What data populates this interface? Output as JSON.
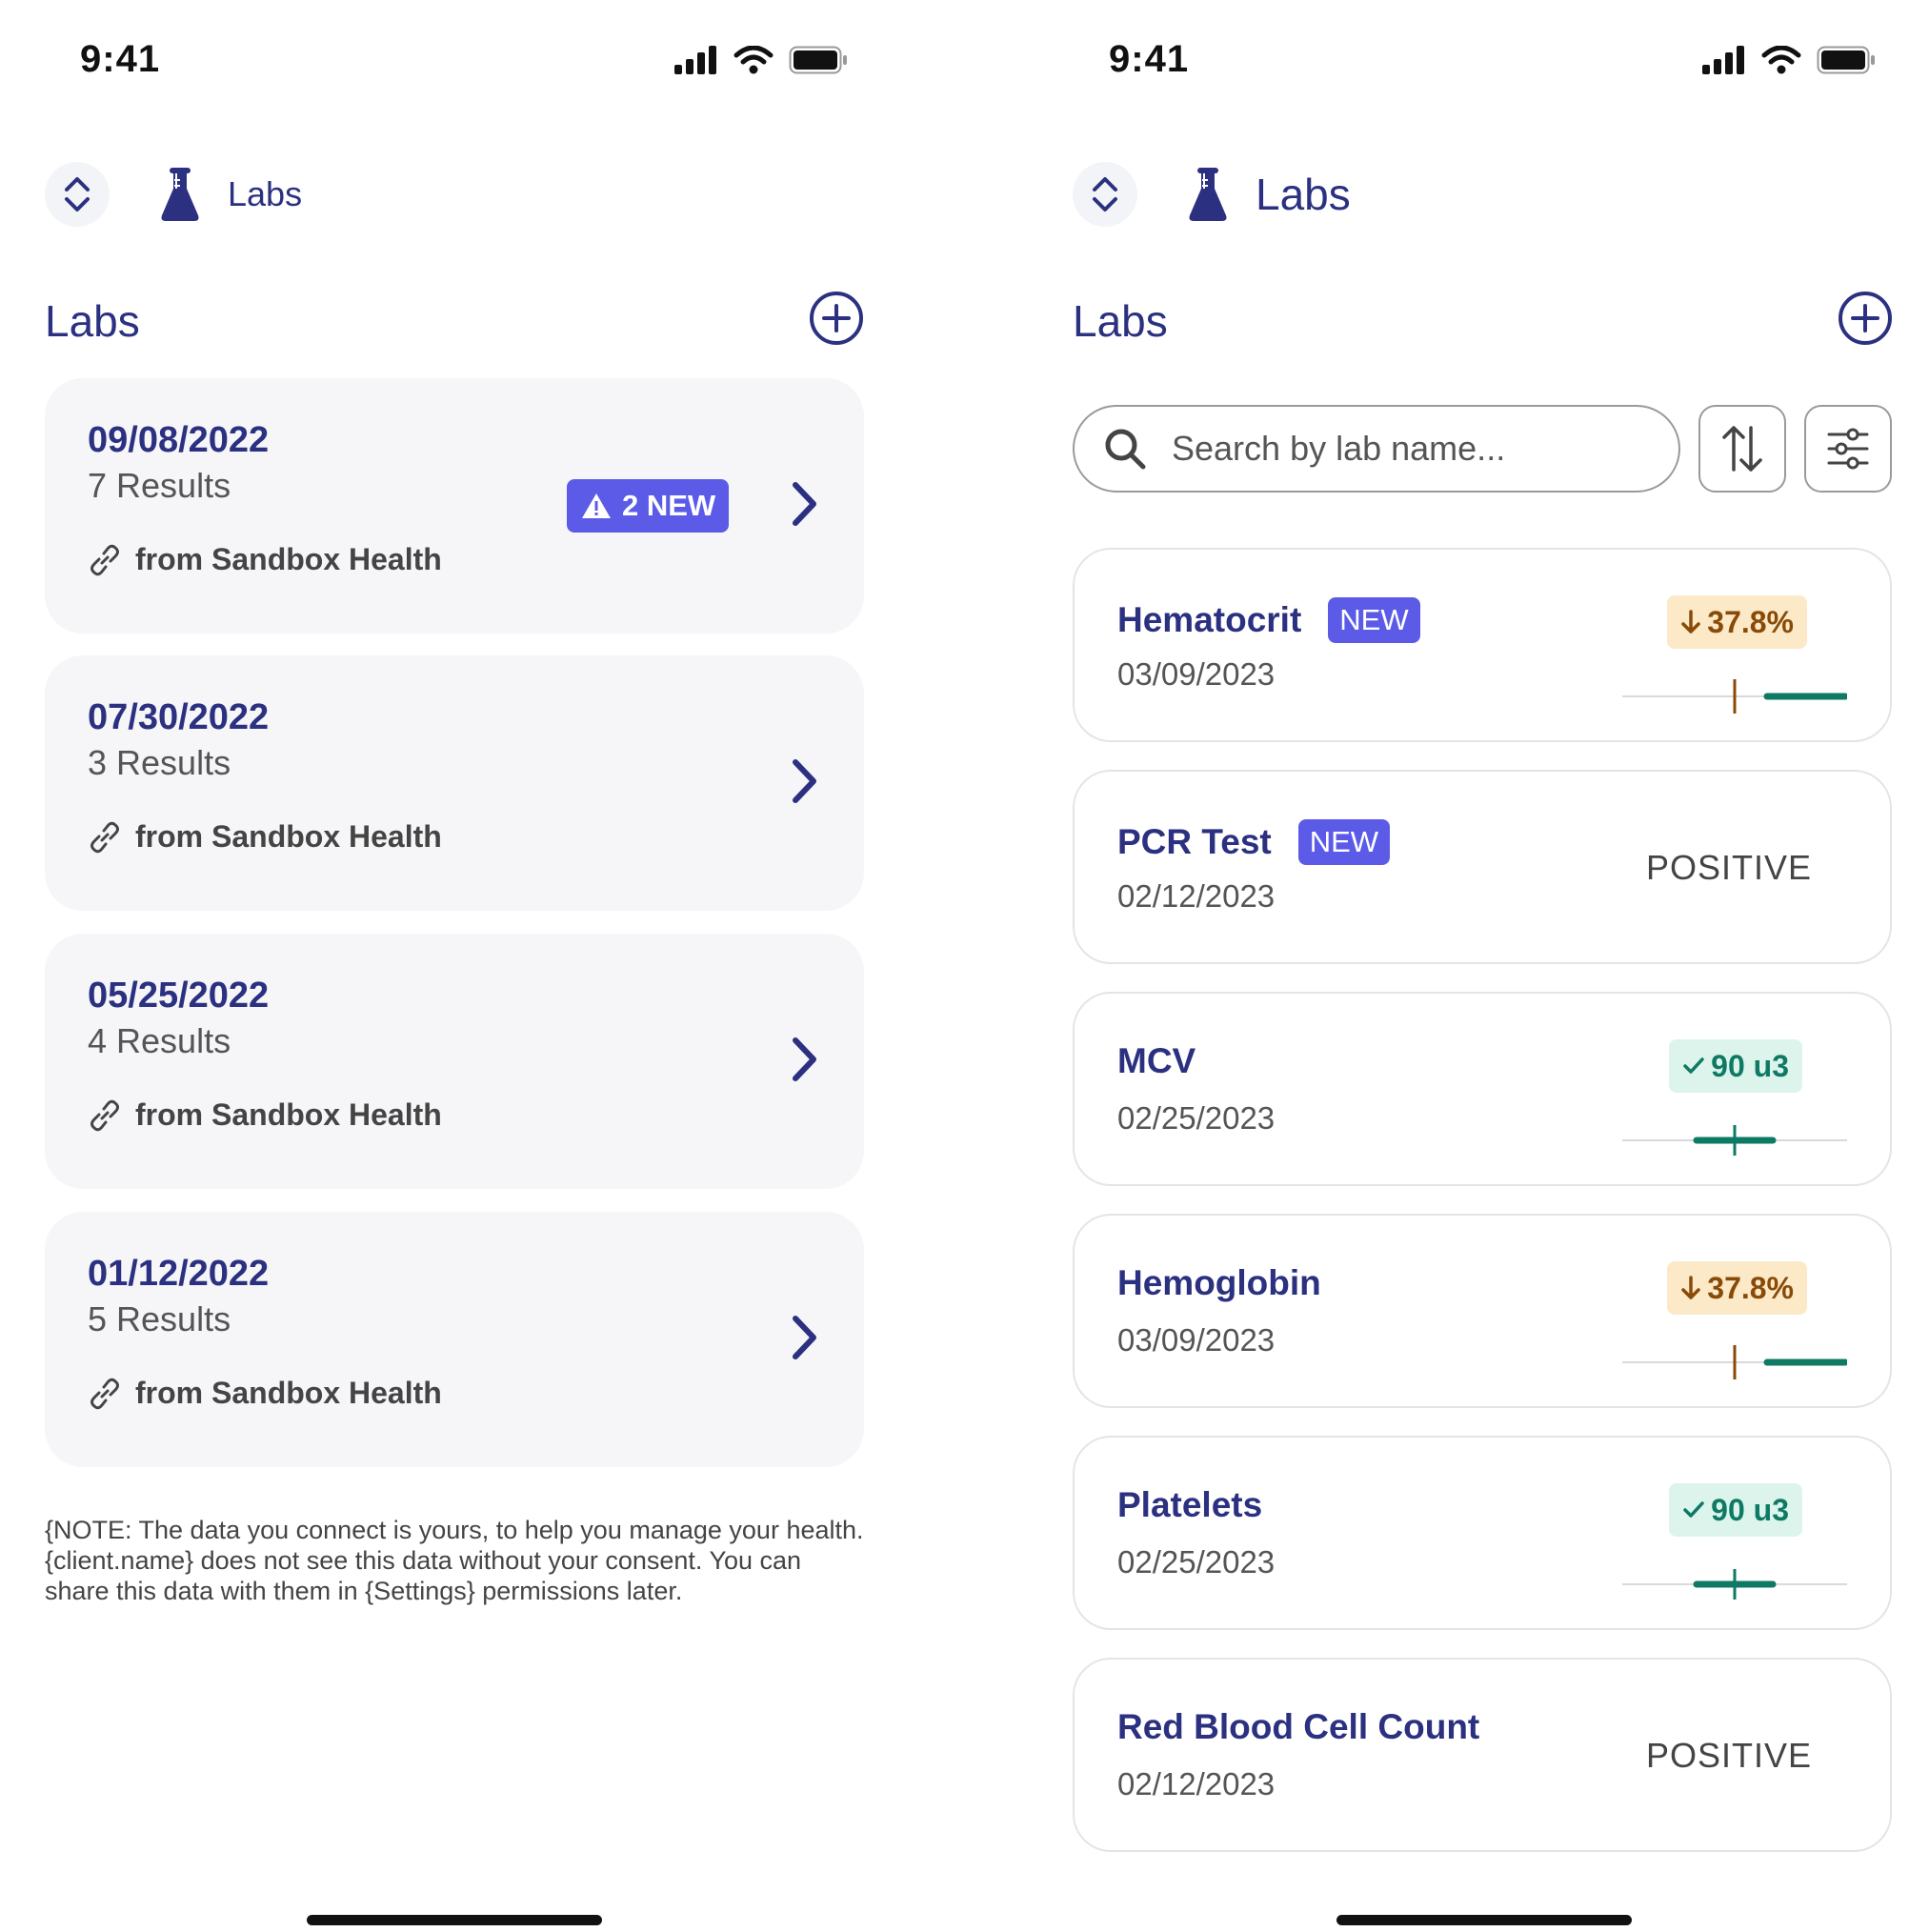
{
  "status_bar": {
    "time": "9:41"
  },
  "left": {
    "header_title": "Labs",
    "section_title": "Labs",
    "visits": [
      {
        "date": "09/08/2022",
        "results": "7 Results",
        "source": "from Sandbox Health",
        "new_badge": "2 NEW"
      },
      {
        "date": "07/30/2022",
        "results": "3 Results",
        "source": "from Sandbox Health"
      },
      {
        "date": "05/25/2022",
        "results": "4 Results",
        "source": "from Sandbox Health"
      },
      {
        "date": "01/12/2022",
        "results": "5 Results",
        "source": "from Sandbox Health"
      }
    ],
    "note": "{NOTE: The data you connect is yours, to help you manage your health. {client.name} does not see this data without your consent. You can share this data with them in {Settings} permissions later."
  },
  "right": {
    "header_title": "Labs",
    "section_title": "Labs",
    "search": {
      "placeholder": "Search by lab name..."
    },
    "labs": [
      {
        "name": "Hematocrit",
        "new": "NEW",
        "date": "03/09/2023",
        "value": "37.8%",
        "status": "low"
      },
      {
        "name": "PCR Test",
        "new": "NEW",
        "date": "02/12/2023",
        "value": "POSITIVE",
        "status": "text"
      },
      {
        "name": "MCV",
        "date": "02/25/2023",
        "value": "90 u3",
        "status": "normal"
      },
      {
        "name": "Hemoglobin",
        "date": "03/09/2023",
        "value": "37.8%",
        "status": "low"
      },
      {
        "name": "Platelets",
        "date": "02/25/2023",
        "value": "90 u3",
        "status": "normal"
      },
      {
        "name": "Red Blood Cell Count",
        "date": "02/12/2023",
        "value": "POSITIVE",
        "status": "text"
      }
    ]
  },
  "colors": {
    "primary": "#2b3180",
    "accent": "#5b5be8",
    "warn_bg": "#fbe9c8",
    "warn_text": "#8a4a07",
    "ok_bg": "#dcf4ec",
    "ok_text": "#0e7a63",
    "card_bg": "#f6f6f9"
  },
  "icons": [
    "signal-icon",
    "wifi-icon",
    "battery-icon",
    "switch-icon",
    "flask-icon",
    "add-icon",
    "warning-icon",
    "chevron-right-icon",
    "link-icon",
    "search-icon",
    "sort-icon",
    "filter-icon",
    "arrow-down-icon",
    "check-icon"
  ]
}
